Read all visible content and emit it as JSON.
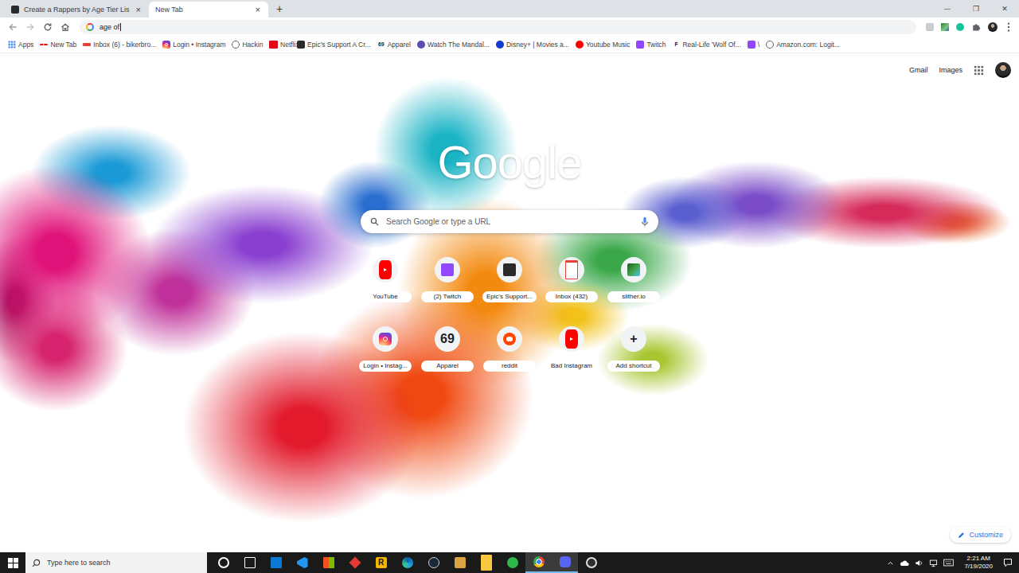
{
  "tabs": [
    {
      "label": "Create a Rappers by Age Tier Lis",
      "selected": false,
      "kind": "page",
      "close": "×"
    },
    {
      "label": "New Tab",
      "selected": true,
      "kind": "newtab",
      "close": "×"
    }
  ],
  "new_tab": "+",
  "window_controls": [
    "—",
    "❐",
    "✕"
  ],
  "omnibox": {
    "value": "age of"
  },
  "bookmarks": [
    {
      "label": "Apps",
      "kind": "apps"
    },
    {
      "label": "New Tab",
      "kind": "youtube"
    },
    {
      "label": "Inbox (6) - bikerbro...",
      "kind": "gmail"
    },
    {
      "label": "Login • Instagram",
      "kind": "instagram"
    },
    {
      "label": "Hackin",
      "kind": "globe"
    },
    {
      "label": "Netflix",
      "kind": "netflix"
    },
    {
      "label": "Epic's Support A Cr...",
      "kind": "epic"
    },
    {
      "label": "Apparel",
      "kind": "text",
      "icon_text": "69"
    },
    {
      "label": "Watch The Mandal...",
      "kind": "mando"
    },
    {
      "label": "Disney+ | Movies a...",
      "kind": "disney"
    },
    {
      "label": "Youtube Music",
      "kind": "ytmusic"
    },
    {
      "label": "Twitch",
      "kind": "twitch"
    },
    {
      "label": "Real-Life 'Wolf Of...",
      "kind": "text",
      "icon_text": "F"
    },
    {
      "label": "\\",
      "kind": "twitch"
    },
    {
      "label": "Amazon.com: Logit...",
      "kind": "globe"
    }
  ],
  "header_links": [
    "Gmail",
    "Images"
  ],
  "logo": "Google",
  "search": {
    "placeholder": "Search Google or type a URL"
  },
  "shortcuts": [
    {
      "label": "YouTube",
      "kind": "youtube"
    },
    {
      "label": "(2) Twitch",
      "kind": "twitch"
    },
    {
      "label": "Epic's Support...",
      "kind": "epic"
    },
    {
      "label": "Inbox (432)",
      "kind": "gmail"
    },
    {
      "label": "slither.io",
      "kind": "slither"
    },
    {
      "label": "Login • Instag...",
      "kind": "instagram"
    },
    {
      "label": "Apparel",
      "kind": "text",
      "icon_text": "69"
    },
    {
      "label": "reddit",
      "kind": "reddit"
    },
    {
      "label": "Bad Instagram",
      "kind": "youtube"
    },
    {
      "label": "Add shortcut",
      "kind": "text",
      "icon_text": "+"
    }
  ],
  "customize": "Customize",
  "taskbar": {
    "search_placeholder": "Type here to search",
    "apps": [
      {
        "kind": "cortana",
        "running": false
      },
      {
        "kind": "taskview",
        "running": false
      },
      {
        "kind": "mail",
        "running": false
      },
      {
        "kind": "vscode",
        "running": false
      },
      {
        "kind": "store",
        "running": false
      },
      {
        "kind": "diamond",
        "running": false
      },
      {
        "kind": "text",
        "icon_text": "R",
        "running": false
      },
      {
        "kind": "edge",
        "running": false
      },
      {
        "kind": "steam",
        "running": false
      },
      {
        "kind": "game",
        "running": false
      },
      {
        "kind": "folder",
        "running": false
      },
      {
        "kind": "xbox",
        "running": false
      },
      {
        "kind": "chrome",
        "running": true
      },
      {
        "kind": "discord",
        "running": true
      },
      {
        "kind": "obs",
        "running": false
      }
    ],
    "time": "2:21 AM",
    "date": "7/19/2020"
  }
}
